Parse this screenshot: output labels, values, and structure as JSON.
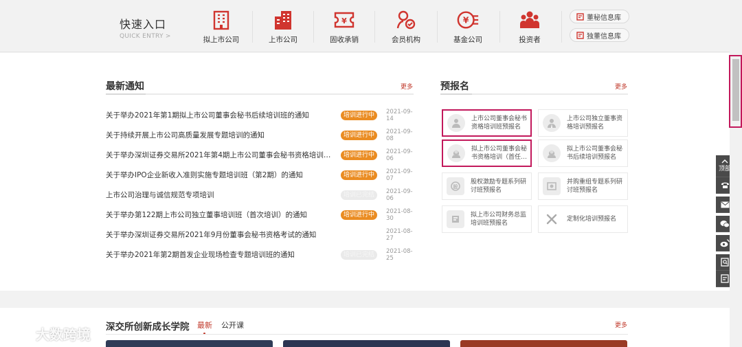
{
  "quick_entry": {
    "title": "快速入口",
    "subtitle": "QUICK ENTRY >",
    "items": [
      {
        "label": "拟上市公司",
        "icon": "building-icon"
      },
      {
        "label": "上市公司",
        "icon": "office-tower-icon"
      },
      {
        "label": "固收承销",
        "icon": "ticket-icon"
      },
      {
        "label": "会员机构",
        "icon": "member-badge-icon"
      },
      {
        "label": "基金公司",
        "icon": "yen-coin-icon"
      },
      {
        "label": "投资者",
        "icon": "people-group-icon"
      }
    ],
    "pills": [
      {
        "label": "董秘信息库"
      },
      {
        "label": "独董信息库"
      }
    ],
    "accent": "#c0392b"
  },
  "notices": {
    "title": "最新通知",
    "more": "更多",
    "items": [
      {
        "title": "关于举办2021年第1期拟上市公司董事会秘书后续培训班的通知",
        "status": "培训进行中",
        "date": "2021-09-14",
        "active": true
      },
      {
        "title": "关于持续开展上市公司高质量发展专题培训的通知",
        "status": "培训进行中",
        "date": "2021-09-08",
        "active": true
      },
      {
        "title": "关于举办深圳证券交易所2021年第4期上市公司董事会秘书资格培训班…",
        "status": "培训进行中",
        "date": "2021-09-06",
        "active": true
      },
      {
        "title": "关于举办IPO企业新收入准则实施专题培训班（第2期）的通知",
        "status": "培训进行中",
        "date": "2021-09-07",
        "active": true
      },
      {
        "title": "上市公司治理与诚信规范专项培训",
        "status": "培训已完结",
        "date": "2021-09-06",
        "active": false
      },
      {
        "title": "关于举办第122期上市公司独立董事培训班（首次培训）的通知",
        "status": "培训进行中",
        "date": "2021-08-30",
        "active": true
      },
      {
        "title": "关于举办深圳证券交易所2021年9月份董事会秘书资格考试的通知",
        "status": "",
        "date": "2021-08-27",
        "active": false
      },
      {
        "title": "关于举办2021年第2期首发企业现场检查专题培训班的通知",
        "status": "培训已完结",
        "date": "2021-08-25",
        "active": false
      }
    ],
    "status_colors": {
      "active": "#ea8c22",
      "done": "#eaeaea"
    }
  },
  "prereg": {
    "title": "预报名",
    "more": "更多",
    "cards": [
      {
        "label": "上市公司董事会秘书资格培训班预报名",
        "icon": "person-badge-icon",
        "highlighted": true
      },
      {
        "label": "上市公司独立董事资格培训预报名",
        "icon": "person-suit-icon",
        "highlighted": false
      },
      {
        "label": "拟上市公司董事会秘书资格培训（首任…",
        "icon": "person-woman-icon",
        "highlighted": true
      },
      {
        "label": "拟上市公司董事会秘书后续培训预报名",
        "icon": "person-gear-icon",
        "highlighted": false
      },
      {
        "label": "股权激励专题系列研讨班预报名",
        "icon": "stock-badge-icon",
        "highlighted": false
      },
      {
        "label": "并购重组专题系列研讨班预报名",
        "icon": "merger-icon",
        "highlighted": false
      },
      {
        "label": "拟上市公司财务总监培训班预报名",
        "icon": "finance-icon",
        "highlighted": false
      },
      {
        "label": "定制化培训预报名",
        "icon": "tools-icon",
        "highlighted": false
      }
    ],
    "highlight_color": "#c2185b"
  },
  "academy": {
    "title": "深交所创新成长学院",
    "tabs": [
      "最新",
      "公开课"
    ],
    "more": "更多"
  },
  "side_tools": {
    "top_label": "顶部",
    "items": [
      "phone-icon",
      "mail-icon",
      "wechat-icon",
      "weibo-icon",
      "search-doc-icon",
      "doc-icon"
    ]
  },
  "watermark": "大数跨境"
}
